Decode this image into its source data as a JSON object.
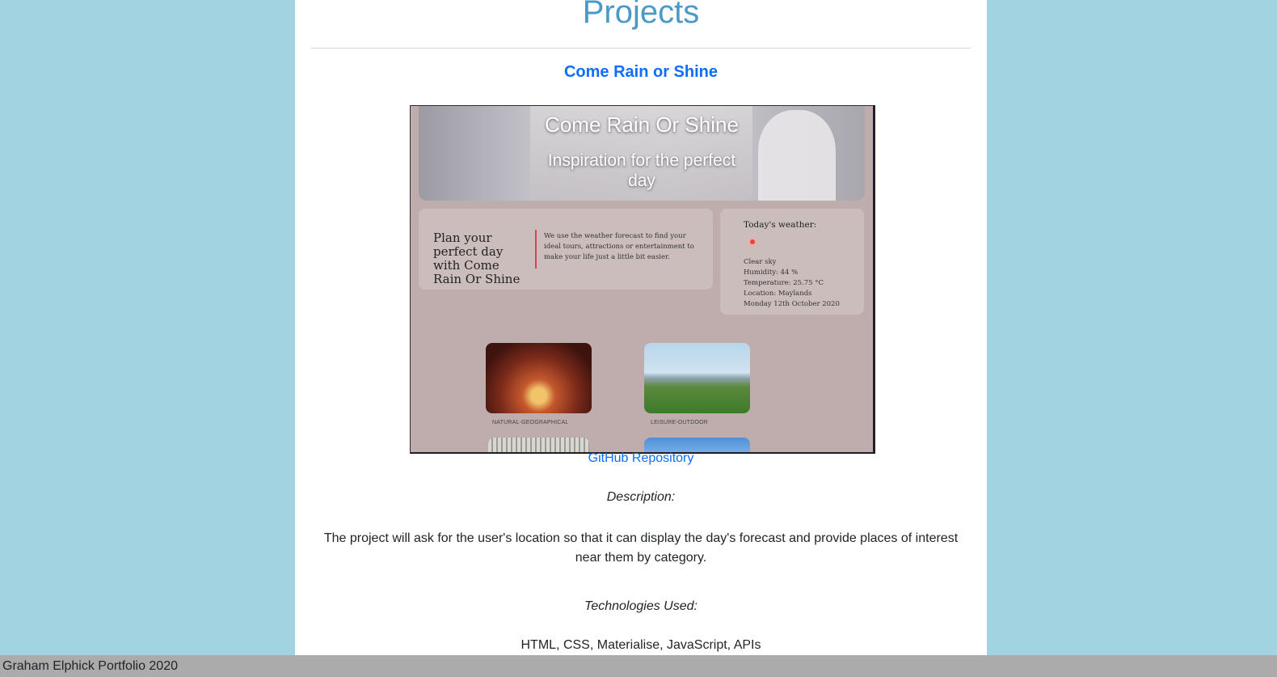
{
  "page": {
    "heading": "Projects"
  },
  "project": {
    "title": "Come Rain or Shine",
    "screenshot": {
      "hero_title": "Come Rain Or Shine",
      "hero_subtitle": "Inspiration for the perfect day",
      "plan_heading": "Plan your perfect day with Come Rain Or Shine",
      "plan_text": "We use the weather forecast to find your ideal tours, attractions or entertainment to make your life just a little bit easier.",
      "weather_heading": "Today's weather:",
      "weather_lines": [
        "Clear sky",
        "Humidity: 44 %",
        "Temperature: 25.75 °C",
        "Location: Maylands",
        "Monday 12th October 2020"
      ],
      "categories": [
        "NATURAL-GEOGRAPHICAL",
        "LEISURE-OUTDOOR"
      ]
    },
    "repo_link": "GitHub Repository",
    "description_label": "Description:",
    "description": "The project will ask for the user's location so that it can display the day's forecast and provide places of interest near them by category.",
    "technologies_label": "Technologies Used:",
    "technologies": "HTML, CSS, Materialise, JavaScript, APIs"
  },
  "footer": {
    "text": "Graham Elphick Portfolio 2020"
  },
  "colors": {
    "background": "#a2d3e0",
    "heading": "#4a9ac9",
    "link": "#0d6efd",
    "footer": "#ababab"
  }
}
